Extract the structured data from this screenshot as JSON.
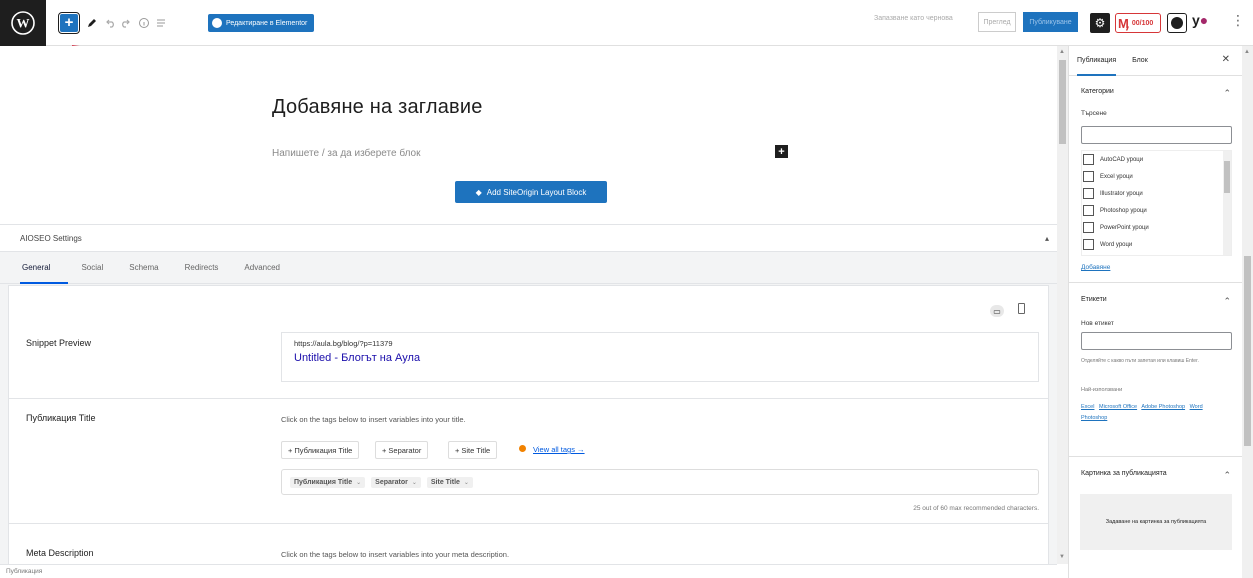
{
  "toolbar": {
    "elementor_label": "Редактиране в Elementor",
    "draft_label": "Запазване като чернова",
    "preview_label": "Преглед",
    "publish_label": "Публикуване",
    "aioseo_score": "00/100",
    "undo_icon": "undo-icon",
    "redo_icon": "redo-icon"
  },
  "editor": {
    "title_placeholder": "Добавяне на заглавие",
    "block_placeholder": "Напишете / за да изберете блок",
    "siteorigin_label": "Add SiteOrigin Layout Block"
  },
  "aioseo": {
    "header": "AIOSEO Settings",
    "tabs": [
      "General",
      "Social",
      "Schema",
      "Redirects",
      "Advanced"
    ],
    "snippet_label": "Snippet Preview",
    "snippet_url": "https://aula.bg/blog/?p=11379",
    "snippet_title": "Untitled - Блогът на Аула",
    "title_label": "Публикация Title",
    "title_help": "Click on the tags below to insert variables into your title.",
    "tag_buttons": [
      "Публикация Title",
      "Separator",
      "Site Title"
    ],
    "view_all": "View all tags →",
    "title_pills": [
      "Публикация Title",
      "Separator",
      "Site Title"
    ],
    "char_count": "25 out of 60 max recommended characters.",
    "meta_label": "Meta Description",
    "meta_help": "Click on the tags below to insert variables into your meta description."
  },
  "status": {
    "breadcrumb": "Публикация"
  },
  "sidebar": {
    "tabs": [
      "Публикация",
      "Блок"
    ],
    "categories": {
      "title": "Категории",
      "search_label": "Търсене",
      "items": [
        "AutoCAD уроци",
        "Excel уроци",
        "Illustrator уроци",
        "Photoshop уроци",
        "PowerPoint уроци",
        "Word уроци"
      ],
      "add_link": "Добавяне"
    },
    "tags": {
      "title": "Етикети",
      "new_label": "Нов етикет",
      "hint": "Отделяйте с какво пъти запетая или клавиш Enter.",
      "popular_label": "Най-използвани",
      "tag_links": [
        "Excel",
        "Microsoft Office",
        "Adobe Photoshop",
        "Word",
        "Photoshop"
      ]
    },
    "featured": {
      "title": "Картинка за публикацията",
      "set_label": "Задаване на картинка за публикацията"
    }
  },
  "colors": {
    "accent": "#1e73be",
    "annotation": "#d0021b",
    "aioseo_red": "#d63638"
  }
}
